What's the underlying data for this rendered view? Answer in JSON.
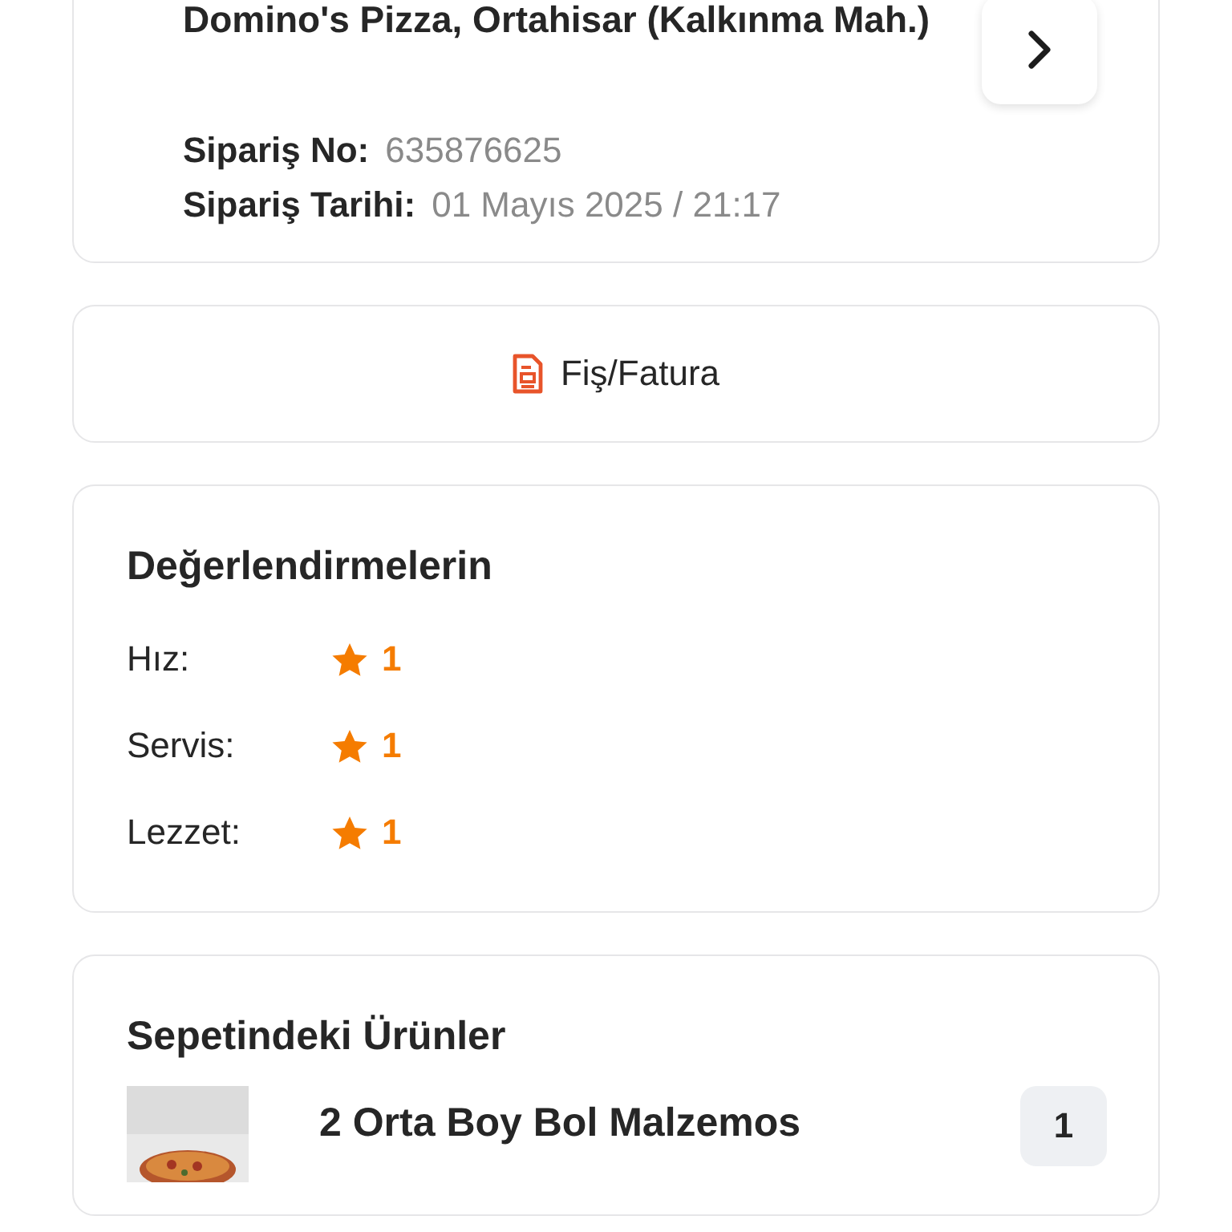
{
  "restaurant": {
    "name": "Domino's Pizza, Ortahisar (Kalkınma Mah.)"
  },
  "order_info": [
    {
      "label": "Sipariş No:",
      "value": "635876625"
    },
    {
      "label": "Sipariş Tarihi:",
      "value": "01 Mayıs 2025 / 21:17"
    }
  ],
  "receipt_button": {
    "label": "Fiş/Fatura"
  },
  "ratings": {
    "title": "Değerlendirmelerin",
    "items": [
      {
        "label": "Hız:",
        "value": "1"
      },
      {
        "label": "Servis:",
        "value": "1"
      },
      {
        "label": "Lezzet:",
        "value": "1"
      }
    ]
  },
  "basket": {
    "title": "Sepetindeki Ürünler",
    "items": [
      {
        "kind": "picture",
        "name": "2 Orta Boy Bol Malzemos",
        "quantity": "1"
      }
    ]
  }
}
